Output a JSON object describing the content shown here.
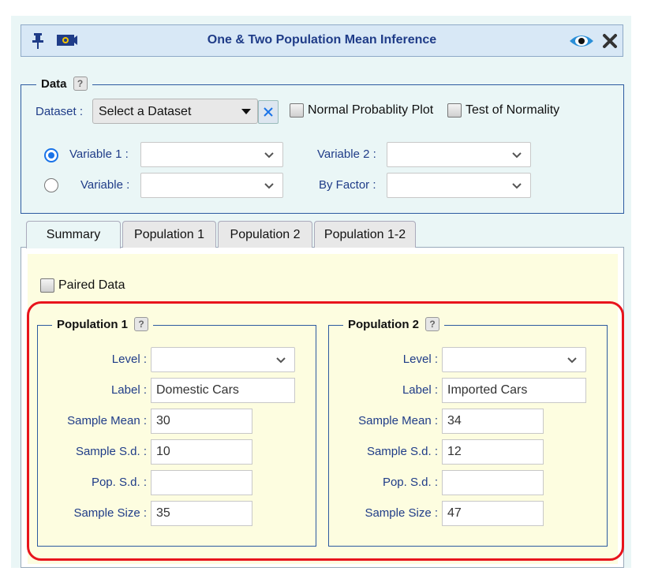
{
  "window": {
    "title": "One & Two Population Mean Inference"
  },
  "toolbar_icons": [
    "pin-icon",
    "camera-icon",
    "eye-icon",
    "close-icon"
  ],
  "data_section": {
    "legend": "Data",
    "help": "?",
    "dataset_label": "Dataset :",
    "dataset_value": "Select a Dataset",
    "normal_plot_label": "Normal Probablity Plot",
    "normality_test_label": "Test of Normality",
    "variable1_label": "Variable 1 :",
    "variable2_label": "Variable 2 :",
    "variable_label": "Variable :",
    "by_factor_label": "By Factor :"
  },
  "tabs": [
    "Summary",
    "Population 1",
    "Population 2",
    "Population 1-2"
  ],
  "summary": {
    "paired_label": "Paired Data",
    "field_labels": {
      "level": "Level :",
      "label": "Label :",
      "mean": "Sample Mean :",
      "sd": "Sample S.d. :",
      "popsd": "Pop. S.d. :",
      "size": "Sample Size :"
    },
    "population1": {
      "legend": "Population 1",
      "help": "?",
      "label": "Domestic Cars",
      "mean": "30",
      "sd": "10",
      "popsd": "",
      "size": "35"
    },
    "population2": {
      "legend": "Population 2",
      "help": "?",
      "label": "Imported Cars",
      "mean": "34",
      "sd": "12",
      "popsd": "",
      "size": "47"
    }
  },
  "colors": {
    "highlight_border": "#e8141c",
    "accent_blue": "#1f3c88"
  }
}
